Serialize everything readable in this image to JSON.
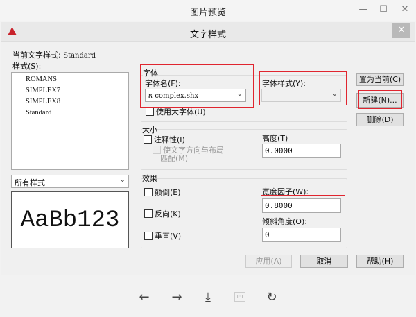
{
  "window": {
    "title": "图片预览",
    "minimize": "—",
    "maximize": "☐",
    "close": "✕"
  },
  "dialog": {
    "title": "文字样式",
    "close": "✕",
    "app_icon": "autocad-logo-icon",
    "current_style_label": "当前文字样式:",
    "current_style": "Standard",
    "styles_label": "样式(S):",
    "styles": [
      "ROMANS",
      "SIMPLEX7",
      "SIMPLEX8",
      "Standard"
    ],
    "filter": "所有样式",
    "preview_text": "AaBb123",
    "font": {
      "group": "字体",
      "font_name_label": "字体名(F):",
      "font_name": "complex.shx",
      "font_style_label": "字体样式(Y):",
      "font_style": "",
      "big_font_label": "使用大字体(U)"
    },
    "size": {
      "group": "大小",
      "annotative_label": "注释性(I)",
      "match_label_1": "使文字方向与布局",
      "match_label_2": "匹配(M)",
      "height_label": "高度(T)",
      "height": "0.0000"
    },
    "effects": {
      "group": "效果",
      "upside_down": "颠倒(E)",
      "backwards": "反向(K)",
      "vertical": "垂直(V)",
      "width_factor_label": "宽度因子(W):",
      "width_factor": "0.8000",
      "oblique_label": "倾斜角度(O):",
      "oblique": "0"
    },
    "buttons": {
      "set_current": "置为当前(C)",
      "new": "新建(N)...",
      "delete": "删除(D)",
      "apply": "应用(A)",
      "cancel": "取消",
      "help": "帮助(H)"
    }
  },
  "toolbar": {
    "prev": "←",
    "next": "→",
    "download": "⤓",
    "actual_size": "1:1",
    "rotate": "↻"
  }
}
